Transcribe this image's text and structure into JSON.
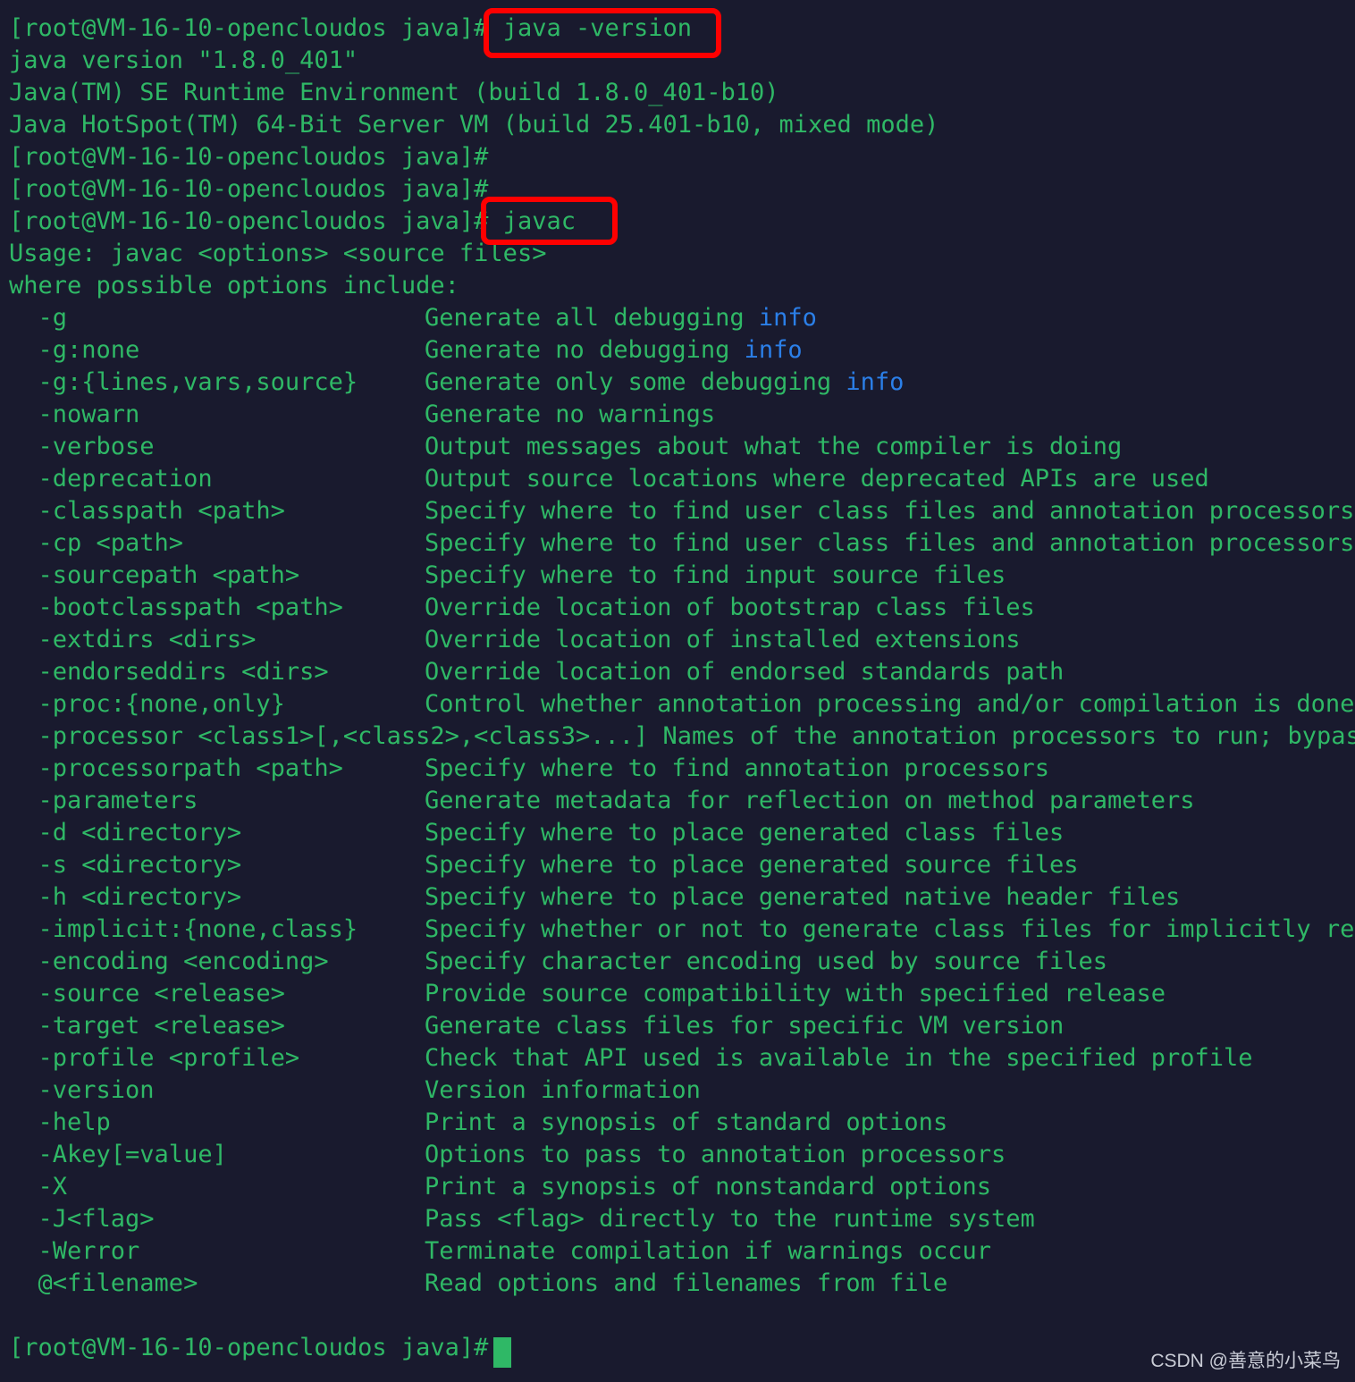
{
  "terminal": {
    "background_color": "#191a2e",
    "text_color": "#2fb866",
    "keyword_color": "#2b7fe8",
    "annotation_color": "#fe0000",
    "prompt": "[root@VM-16-10-opencloudos java]# ",
    "hostname": "VM-16-10-opencloudos",
    "user": "root",
    "cwd": "java",
    "cursor": "block"
  },
  "session": {
    "command_1": "java -version",
    "command_1_full": "[root@VM-16-10-opencloudos java]# java -version",
    "java_version_output": [
      "java version \"1.8.0_401\"",
      "Java(TM) SE Runtime Environment (build 1.8.0_401-b10)",
      "Java HotSpot(TM) 64-Bit Server VM (build 25.401-b10, mixed mode)"
    ],
    "empty_prompt_1": "[root@VM-16-10-opencloudos java]# ",
    "empty_prompt_2": "[root@VM-16-10-opencloudos java]# ",
    "command_2": "javac",
    "command_2_prompt": "[root@VM-16-10-opencloudos java]# ",
    "usage_line": "Usage: javac <options> <source files>",
    "where_line": "where possible options include:",
    "final_prompt": "[root@VM-16-10-opencloudos java]# "
  },
  "javac_options": [
    {
      "flag": "  -g",
      "desc_pre": "Generate all debugging ",
      "keyword": "info",
      "desc_post": ""
    },
    {
      "flag": "  -g:none",
      "desc_pre": "Generate no debugging ",
      "keyword": "info",
      "desc_post": ""
    },
    {
      "flag": "  -g:{lines,vars,source}",
      "desc_pre": "Generate only some debugging ",
      "keyword": "info",
      "desc_post": ""
    },
    {
      "flag": "  -nowarn",
      "desc_pre": "Generate no warnings",
      "keyword": "",
      "desc_post": ""
    },
    {
      "flag": "  -verbose",
      "desc_pre": "Output messages about what the compiler is doing",
      "keyword": "",
      "desc_post": ""
    },
    {
      "flag": "  -deprecation",
      "desc_pre": "Output source locations where deprecated APIs are used",
      "keyword": "",
      "desc_post": ""
    },
    {
      "flag": "  -classpath <path>",
      "desc_pre": "Specify where to find user class files and annotation processors",
      "keyword": "",
      "desc_post": ""
    },
    {
      "flag": "  -cp <path>",
      "desc_pre": "Specify where to find user class files and annotation processors",
      "keyword": "",
      "desc_post": ""
    },
    {
      "flag": "  -sourcepath <path>",
      "desc_pre": "Specify where to find input source files",
      "keyword": "",
      "desc_post": ""
    },
    {
      "flag": "  -bootclasspath <path>",
      "desc_pre": "Override location of bootstrap class files",
      "keyword": "",
      "desc_post": ""
    },
    {
      "flag": "  -extdirs <dirs>",
      "desc_pre": "Override location of installed extensions",
      "keyword": "",
      "desc_post": ""
    },
    {
      "flag": "  -endorseddirs <dirs>",
      "desc_pre": "Override location of endorsed standards path",
      "keyword": "",
      "desc_post": ""
    },
    {
      "flag": "  -proc:{none,only}",
      "desc_pre": "Control whether annotation processing and/or compilation is done.",
      "keyword": "",
      "desc_post": ""
    },
    {
      "flag": "  -processor <class1>[,<class2>,<class3>...] ",
      "desc_pre": "Names of the annotation processors to run; bypass",
      "keyword": "",
      "desc_post": "",
      "inline": true
    },
    {
      "flag": "  -processorpath <path>",
      "desc_pre": "Specify where to find annotation processors",
      "keyword": "",
      "desc_post": ""
    },
    {
      "flag": "  -parameters",
      "desc_pre": "Generate metadata for reflection on method parameters",
      "keyword": "",
      "desc_post": ""
    },
    {
      "flag": "  -d <directory>",
      "desc_pre": "Specify where to place generated class files",
      "keyword": "",
      "desc_post": ""
    },
    {
      "flag": "  -s <directory>",
      "desc_pre": "Specify where to place generated source files",
      "keyword": "",
      "desc_post": ""
    },
    {
      "flag": "  -h <directory>",
      "desc_pre": "Specify where to place generated native header files",
      "keyword": "",
      "desc_post": ""
    },
    {
      "flag": "  -implicit:{none,class}",
      "desc_pre": "Specify whether or not to generate class files for implicitly ref",
      "keyword": "",
      "desc_post": ""
    },
    {
      "flag": "  -encoding <encoding>",
      "desc_pre": "Specify character encoding used by source files",
      "keyword": "",
      "desc_post": ""
    },
    {
      "flag": "  -source <release>",
      "desc_pre": "Provide source compatibility with specified release",
      "keyword": "",
      "desc_post": ""
    },
    {
      "flag": "  -target <release>",
      "desc_pre": "Generate class files for specific VM version",
      "keyword": "",
      "desc_post": ""
    },
    {
      "flag": "  -profile <profile>",
      "desc_pre": "Check that API used is available in the specified profile",
      "keyword": "",
      "desc_post": ""
    },
    {
      "flag": "  -version",
      "desc_pre": "Version information",
      "keyword": "",
      "desc_post": ""
    },
    {
      "flag": "  -help",
      "desc_pre": "Print a synopsis of standard options",
      "keyword": "",
      "desc_post": ""
    },
    {
      "flag": "  -Akey[=value]",
      "desc_pre": "Options to pass to annotation processors",
      "keyword": "",
      "desc_post": ""
    },
    {
      "flag": "  -X",
      "desc_pre": "Print a synopsis of nonstandard options",
      "keyword": "",
      "desc_post": ""
    },
    {
      "flag": "  -J<flag>",
      "desc_pre": "Pass <flag> directly to the runtime system",
      "keyword": "",
      "desc_post": ""
    },
    {
      "flag": "  -Werror",
      "desc_pre": "Terminate compilation if warnings occur",
      "keyword": "",
      "desc_post": ""
    },
    {
      "flag": "  @<filename>",
      "desc_pre": "Read options and filenames from file",
      "keyword": "",
      "desc_post": ""
    }
  ],
  "annotations": [
    {
      "name": "java-version-highlight",
      "label": "java -version"
    },
    {
      "name": "javac-highlight",
      "label": "javac"
    }
  ],
  "watermark": {
    "text": "CSDN @善意的小菜鸟"
  }
}
